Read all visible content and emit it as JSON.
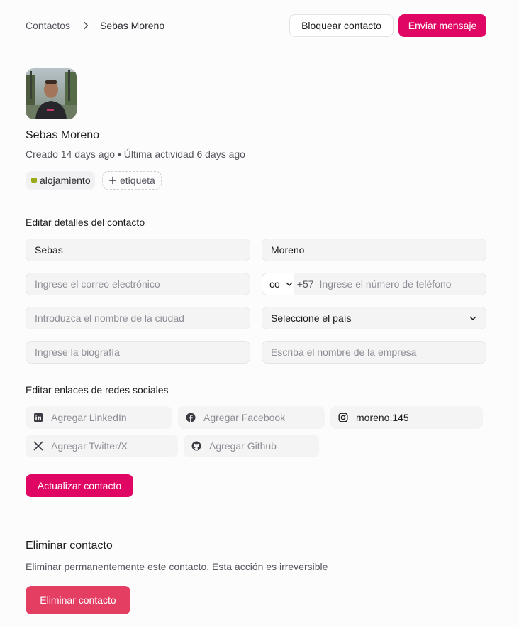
{
  "breadcrumb": {
    "parent": "Contactos",
    "current": "Sebas Moreno"
  },
  "header": {
    "block_label": "Bloquear contacto",
    "send_label": "Enviar mensaje"
  },
  "contact": {
    "name": "Sebas Moreno",
    "meta": "Creado 14 days ago • Última actividad 6 days ago",
    "tag": "alojamiento",
    "add_tag": "etiqueta"
  },
  "details": {
    "title": "Editar detalles del contacto",
    "first_name": "Sebas",
    "last_name": "Moreno",
    "email_placeholder": "Ingrese el correo electrónico",
    "phone_country": "co",
    "phone_dial": "+57",
    "phone_placeholder": "Ingrese el número de teléfono",
    "city_placeholder": "Introduzca el nombre de la ciudad",
    "country_select": "Seleccione el país",
    "bio_placeholder": "Ingrese la biografía",
    "company_placeholder": "Escriba el nombre de la empresa"
  },
  "social": {
    "title": "Editar enlaces de redes sociales",
    "linkedin": "Agregar LinkedIn",
    "facebook": "Agregar Facebook",
    "instagram": "moreno.145",
    "twitter": "Agregar Twitter/X",
    "github": "Agregar Github"
  },
  "update_label": "Actualizar contacto",
  "danger": {
    "title": "Eliminar contacto",
    "description": "Eliminar permanentemente este contacto. Esta acción es irreversible",
    "button": "Eliminar contacto"
  },
  "colors": {
    "brand": "#df0763",
    "danger": "#e43f63",
    "tag_dot": "#9aaa1a"
  }
}
